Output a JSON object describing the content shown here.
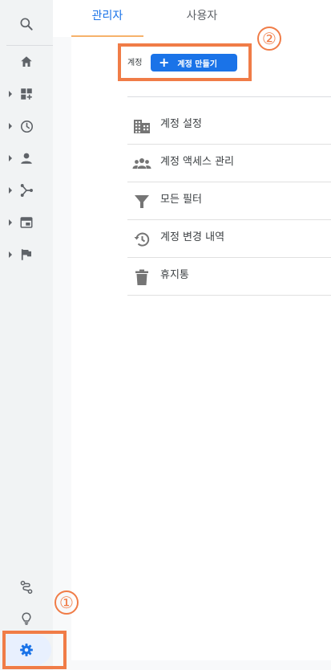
{
  "tabs": [
    {
      "label": "관리자",
      "active": true
    },
    {
      "label": "사용자",
      "active": false
    }
  ],
  "account": {
    "label": "계정",
    "create_button_label": "계정 만들기",
    "create_button_icon": "plus-icon"
  },
  "menu": [
    {
      "label": "계정 설정",
      "icon": "building-icon"
    },
    {
      "label": "계정 액세스 관리",
      "icon": "people-icon"
    },
    {
      "label": "모든 필터",
      "icon": "filter-icon"
    },
    {
      "label": "계정 변경 내역",
      "icon": "history-icon"
    },
    {
      "label": "휴지통",
      "icon": "trash-icon"
    }
  ],
  "rail": {
    "top": [
      "search-icon"
    ],
    "items": [
      "home-icon",
      "dashboard-icon",
      "clock-icon",
      "person-icon",
      "share-icon",
      "display-icon",
      "flag-icon"
    ],
    "bottom": [
      "path-icon",
      "lightbulb-icon",
      "gear-icon"
    ]
  },
  "annotations": {
    "step1": "①",
    "step2": "②"
  },
  "colors": {
    "accent": "#1a73e8",
    "highlight": "#f07c47",
    "rail_bg": "#f1f3f4",
    "active_pill": "#e8f0fe"
  }
}
